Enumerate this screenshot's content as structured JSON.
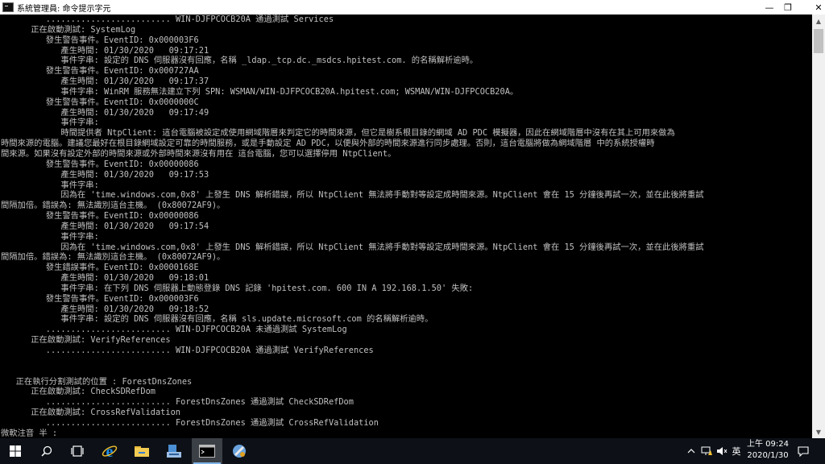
{
  "window": {
    "title": "系統管理員: 命令提示字元",
    "minimize_glyph": "—",
    "maximize_glyph": "❐",
    "close_glyph": "✕"
  },
  "console": {
    "lines": [
      "         ......................... WIN-DJFPCOCB20A 通過測試 Services",
      "      正在啟動測試: SystemLog",
      "         發生警告事件。EventID: 0x000003F6",
      "            產生時間: 01/30/2020   09:17:21",
      "            事件字串: 設定的 DNS 伺服器沒有回應，名稱 _ldap._tcp.dc._msdcs.hpitest.com. 的名稱解析逾時。",
      "         發生警告事件。EventID: 0x000727AA",
      "            產生時間: 01/30/2020   09:17:37",
      "            事件字串: WinRM 服務無法建立下列 SPN: WSMAN/WIN-DJFPCOCB20A.hpitest.com; WSMAN/WIN-DJFPCOCB20A。",
      "         發生警告事件。EventID: 0x0000000C",
      "            產生時間: 01/30/2020   09:17:49",
      "            事件字串:",
      "            時間提供者 NtpClient: 這台電腦被設定成使用網域階層來判定它的時間來源，但它是樹系根目錄的網域 AD PDC 模擬器，因此在網域階層中沒有在其上可用來做為",
      "時間來源的電腦。建議您最好在根目錄網域設定可靠的時間服務，或是手動設定 AD PDC，以便與外部的時間來源進行同步處理。否則，這台電腦將做為網域階層 中的系統授權時",
      "間來源。如果沒有設定外部的時間來源或外部時間來源沒有用在 這台電腦，您可以選擇停用 NtpClient。",
      "         發生警告事件。EventID: 0x00000086",
      "            產生時間: 01/30/2020   09:17:53",
      "            事件字串:",
      "            因為在 'time.windows.com,0x8' 上發生 DNS 解析錯誤，所以 NtpClient 無法將手動對等設定成時間來源。NtpClient 會在 15 分鐘後再試一次，並在此後將重試",
      "間隔加倍。錯誤為: 無法識別這台主機。 (0x80072AF9)。",
      "         發生警告事件。EventID: 0x00000086",
      "            產生時間: 01/30/2020   09:17:54",
      "            事件字串:",
      "            因為在 'time.windows.com,0x8' 上發生 DNS 解析錯誤，所以 NtpClient 無法將手動對等設定成時間來源。NtpClient 會在 15 分鐘後再試一次，並在此後將重試",
      "間隔加倍。錯誤為: 無法識別這台主機。 (0x80072AF9)。",
      "         發生錯誤事件。EventID: 0x0000168E",
      "            產生時間: 01/30/2020   09:18:01",
      "            事件字串: 在下列 DNS 伺服器上動態登錄 DNS 記錄 'hpitest.com. 600 IN A 192.168.1.50' 失敗:",
      "         發生警告事件。EventID: 0x000003F6",
      "            產生時間: 01/30/2020   09:18:52",
      "            事件字串: 設定的 DNS 伺服器沒有回應，名稱 sls.update.microsoft.com 的名稱解析逾時。",
      "         ......................... WIN-DJFPCOCB20A 未通過測試 SystemLog",
      "      正在啟動測試: VerifyReferences",
      "         ......................... WIN-DJFPCOCB20A 通過測試 VerifyReferences",
      "",
      "",
      "   正在執行分割測試的位置 : ForestDnsZones",
      "      正在啟動測試: CheckSDRefDom",
      "         ......................... ForestDnsZones 通過測試 CheckSDRefDom",
      "      正在啟動測試: CrossRefValidation",
      "         ......................... ForestDnsZones 通過測試 CrossRefValidation",
      "微軟注音 半 :"
    ]
  },
  "taskbar": {
    "ime_label": "英",
    "time": "上午 09:24",
    "date": "2020/1/30",
    "icons": [
      "windows-start-icon",
      "search-icon",
      "task-view-icon",
      "internet-explorer-icon",
      "file-explorer-icon",
      "server-manager-icon",
      "command-prompt-icon",
      "ie-setup-icon"
    ]
  },
  "colors": {
    "console_bg": "#000000",
    "console_fg": "#c0c0c0",
    "taskbar_bg": "#0d1117",
    "titlebar_bg": "#ffffff"
  }
}
